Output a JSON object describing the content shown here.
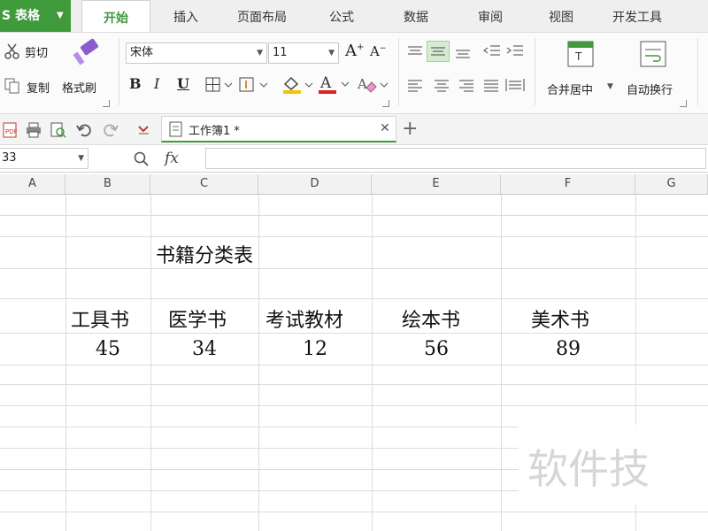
{
  "app": {
    "name": "S 表格",
    "accent": "#3f9a3c"
  },
  "tabs": [
    "开始",
    "插入",
    "页面布局",
    "公式",
    "数据",
    "审阅",
    "视图",
    "开发工具"
  ],
  "ribbon": {
    "cut": "剪切",
    "copy": "复制",
    "format_painter": "格式刷",
    "font_name": "宋体",
    "font_size": "11",
    "merge_center": "合并居中",
    "wrap_text": "自动换行"
  },
  "document": {
    "tab_title": "工作簿1 *"
  },
  "formula_bar": {
    "name_box": "33",
    "fx": "fx",
    "formula": ""
  },
  "columns": [
    "A",
    "B",
    "C",
    "D",
    "E",
    "F",
    "G"
  ],
  "sheet": {
    "title": "书籍分类表",
    "headers": [
      "工具书",
      "医学书",
      "考试教材",
      "绘本书",
      "美术书"
    ],
    "values": [
      "45",
      "34",
      "12",
      "56",
      "89"
    ]
  },
  "watermark": "软件技"
}
